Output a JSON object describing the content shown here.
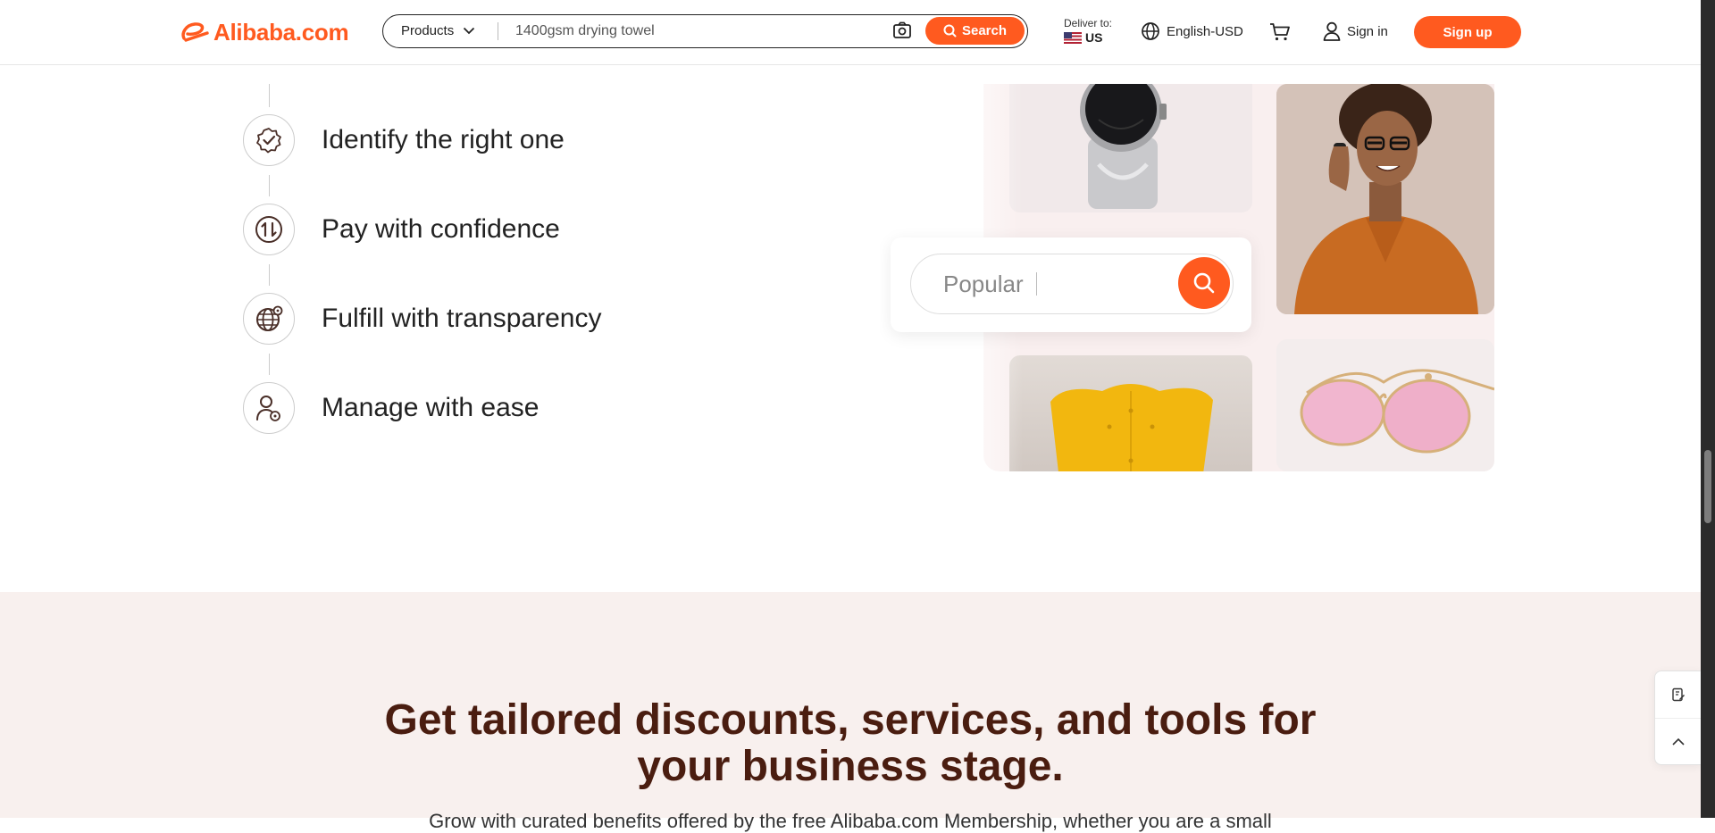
{
  "header": {
    "logo_text": "Alibaba.com",
    "products_label": "Products",
    "search_query": "1400gsm drying towel",
    "search_button": "Search",
    "deliver_label": "Deliver to:",
    "deliver_country": "US",
    "language": "English-USD",
    "sign_in": "Sign in",
    "sign_up": "Sign up"
  },
  "steps": [
    {
      "label": "Identify the right one",
      "icon": "badge-check-icon"
    },
    {
      "label": "Pay with confidence",
      "icon": "exchange-icon"
    },
    {
      "label": "Fulfill with transparency",
      "icon": "globe-icon"
    },
    {
      "label": "Manage with ease",
      "icon": "user-settings-icon"
    }
  ],
  "collage": {
    "search_placeholder": "Popular",
    "images": [
      "smartwatch-image",
      "woman-on-phone-image",
      "yellow-chair-image",
      "pink-sunglasses-image"
    ]
  },
  "section": {
    "headline_line1": "Get tailored discounts, services, and tools for",
    "headline_line2": "your business stage.",
    "subtext": "Grow with curated benefits offered by the free Alibaba.com Membership, whether you are a small"
  },
  "colors": {
    "brand": "#ff5a1f",
    "headline": "#4a1d10",
    "section_bg": "#f8f0ee"
  }
}
